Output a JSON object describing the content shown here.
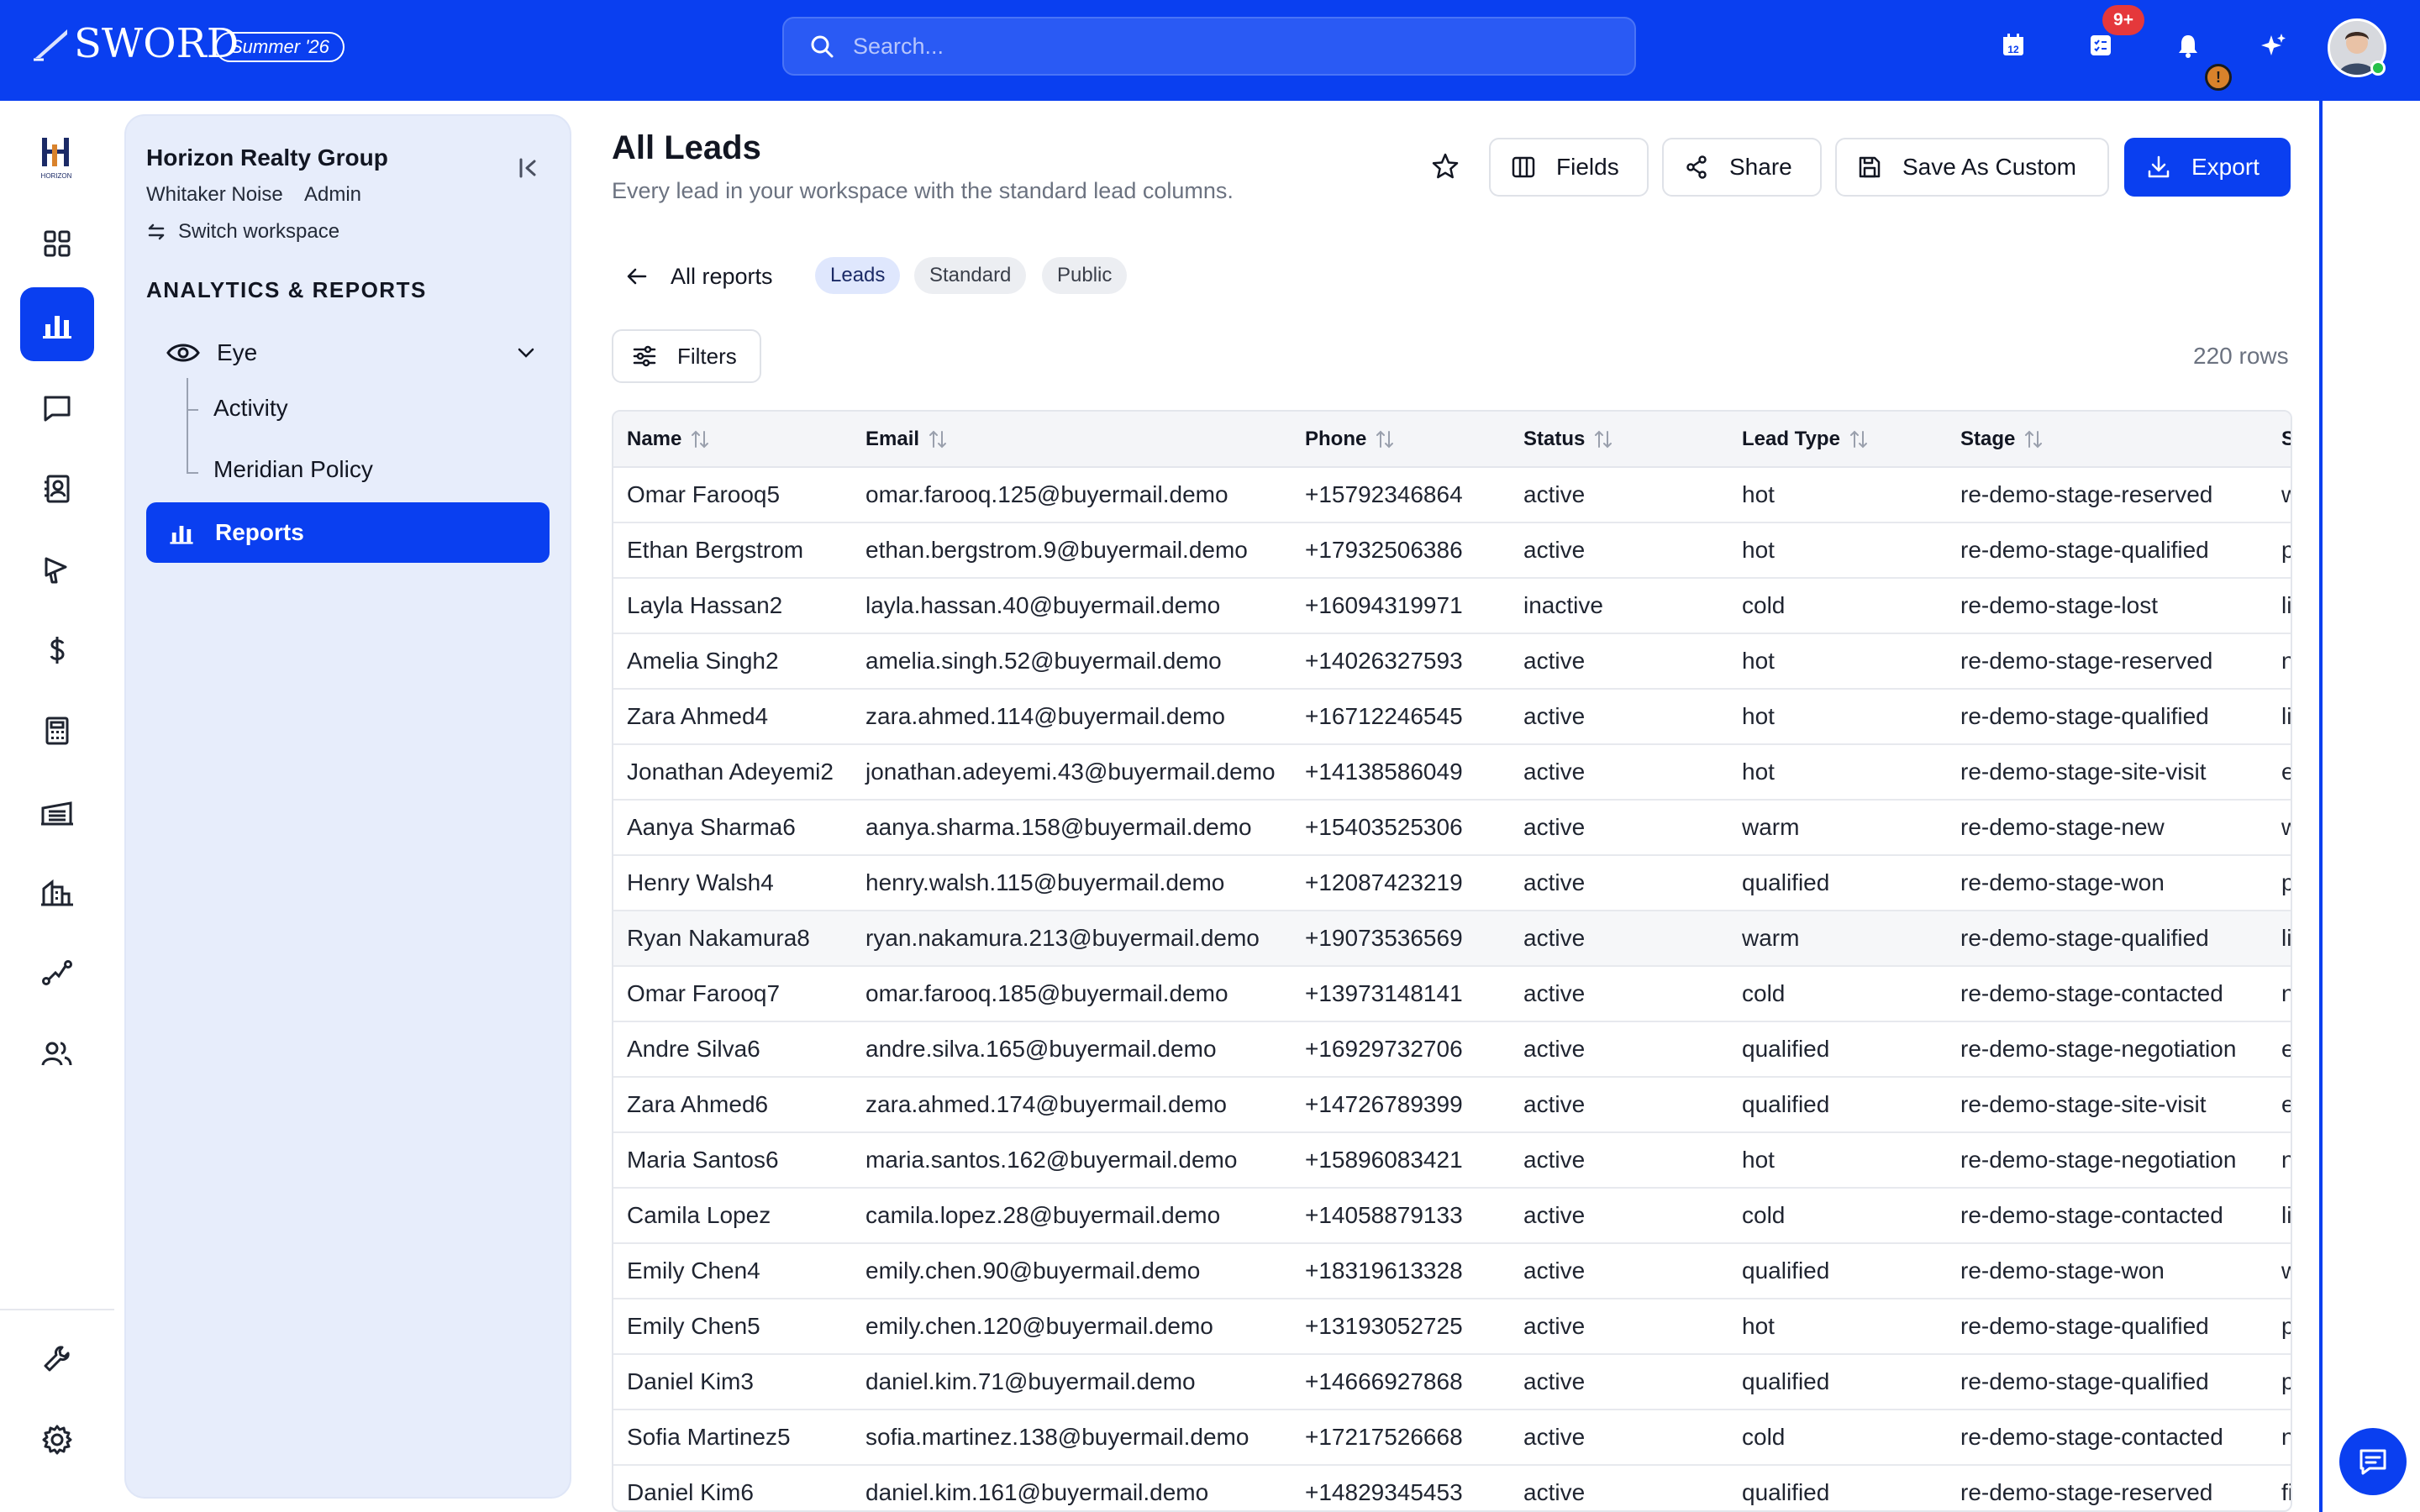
{
  "app": {
    "brand": "SWORD",
    "season": "Summer '26"
  },
  "search": {
    "placeholder": "Search..."
  },
  "topbar": {
    "notification_count": "9+",
    "warning_badge": "!"
  },
  "workspace": {
    "org_name": "Horizon Realty Group",
    "user_name": "Whitaker Noise",
    "role": "Admin",
    "switch_label": "Switch workspace",
    "rail_logo_text": "HORIZON"
  },
  "sidebar": {
    "section_title": "ANALYTICS & REPORTS",
    "group_label": "Eye",
    "children": [
      "Activity",
      "Meridian Policy"
    ],
    "active_item": "Reports"
  },
  "page": {
    "title": "All Leads",
    "subtitle": "Every lead in your workspace with the standard lead columns.",
    "actions": {
      "fields": "Fields",
      "share": "Share",
      "save_custom": "Save As Custom",
      "export": "Export"
    },
    "back_label": "All reports",
    "chips": [
      "Leads",
      "Standard",
      "Public"
    ],
    "filters_label": "Filters",
    "row_count": "220 rows"
  },
  "table": {
    "columns": [
      "Name",
      "Email",
      "Phone",
      "Status",
      "Lead Type",
      "Stage",
      "S"
    ],
    "rows": [
      [
        "Omar Farooq5",
        "omar.farooq.125@buyermail.demo",
        "+15792346864",
        "active",
        "hot",
        "re-demo-stage-reserved",
        "w"
      ],
      [
        "Ethan Bergstrom",
        "ethan.bergstrom.9@buyermail.demo",
        "+17932506386",
        "active",
        "hot",
        "re-demo-stage-qualified",
        "p"
      ],
      [
        "Layla Hassan2",
        "layla.hassan.40@buyermail.demo",
        "+16094319971",
        "inactive",
        "cold",
        "re-demo-stage-lost",
        "li"
      ],
      [
        "Amelia Singh2",
        "amelia.singh.52@buyermail.demo",
        "+14026327593",
        "active",
        "hot",
        "re-demo-stage-reserved",
        "n"
      ],
      [
        "Zara Ahmed4",
        "zara.ahmed.114@buyermail.demo",
        "+16712246545",
        "active",
        "hot",
        "re-demo-stage-qualified",
        "li"
      ],
      [
        "Jonathan Adeyemi2",
        "jonathan.adeyemi.43@buyermail.demo",
        "+14138586049",
        "active",
        "hot",
        "re-demo-stage-site-visit",
        "e"
      ],
      [
        "Aanya Sharma6",
        "aanya.sharma.158@buyermail.demo",
        "+15403525306",
        "active",
        "warm",
        "re-demo-stage-new",
        "w"
      ],
      [
        "Henry Walsh4",
        "henry.walsh.115@buyermail.demo",
        "+12087423219",
        "active",
        "qualified",
        "re-demo-stage-won",
        "p"
      ],
      [
        "Ryan Nakamura8",
        "ryan.nakamura.213@buyermail.demo",
        "+19073536569",
        "active",
        "warm",
        "re-demo-stage-qualified",
        "li"
      ],
      [
        "Omar Farooq7",
        "omar.farooq.185@buyermail.demo",
        "+13973148141",
        "active",
        "cold",
        "re-demo-stage-contacted",
        "n"
      ],
      [
        "Andre Silva6",
        "andre.silva.165@buyermail.demo",
        "+16929732706",
        "active",
        "qualified",
        "re-demo-stage-negotiation",
        "e"
      ],
      [
        "Zara Ahmed6",
        "zara.ahmed.174@buyermail.demo",
        "+14726789399",
        "active",
        "qualified",
        "re-demo-stage-site-visit",
        "e"
      ],
      [
        "Maria Santos6",
        "maria.santos.162@buyermail.demo",
        "+15896083421",
        "active",
        "hot",
        "re-demo-stage-negotiation",
        "n"
      ],
      [
        "Camila Lopez",
        "camila.lopez.28@buyermail.demo",
        "+14058879133",
        "active",
        "cold",
        "re-demo-stage-contacted",
        "li"
      ],
      [
        "Emily Chen4",
        "emily.chen.90@buyermail.demo",
        "+18319613328",
        "active",
        "qualified",
        "re-demo-stage-won",
        "w"
      ],
      [
        "Emily Chen5",
        "emily.chen.120@buyermail.demo",
        "+13193052725",
        "active",
        "hot",
        "re-demo-stage-qualified",
        "p"
      ],
      [
        "Daniel Kim3",
        "daniel.kim.71@buyermail.demo",
        "+14666927868",
        "active",
        "qualified",
        "re-demo-stage-qualified",
        "p"
      ],
      [
        "Sofia Martinez5",
        "sofia.martinez.138@buyermail.demo",
        "+17217526668",
        "active",
        "cold",
        "re-demo-stage-contacted",
        "n"
      ],
      [
        "Daniel Kim6",
        "daniel.kim.161@buyermail.demo",
        "+14829345453",
        "active",
        "qualified",
        "re-demo-stage-reserved",
        "fi"
      ]
    ]
  },
  "colors": {
    "brand_blue": "#0a3ff0",
    "sidebar_bg": "#e7edfb",
    "badge_red": "#e5383b"
  },
  "icons": {
    "rail": [
      "dashboard-icon",
      "reports-icon",
      "messages-icon",
      "contacts-icon",
      "campaigns-icon",
      "dollar-icon",
      "calculator-icon",
      "warehouse-icon",
      "building-icon",
      "route-icon",
      "team-icon"
    ],
    "rail_bottom": [
      "wrench-icon",
      "settings-icon"
    ],
    "topbar": [
      "calendar-icon",
      "tasks-icon",
      "bell-icon",
      "sparkle-icon"
    ]
  }
}
